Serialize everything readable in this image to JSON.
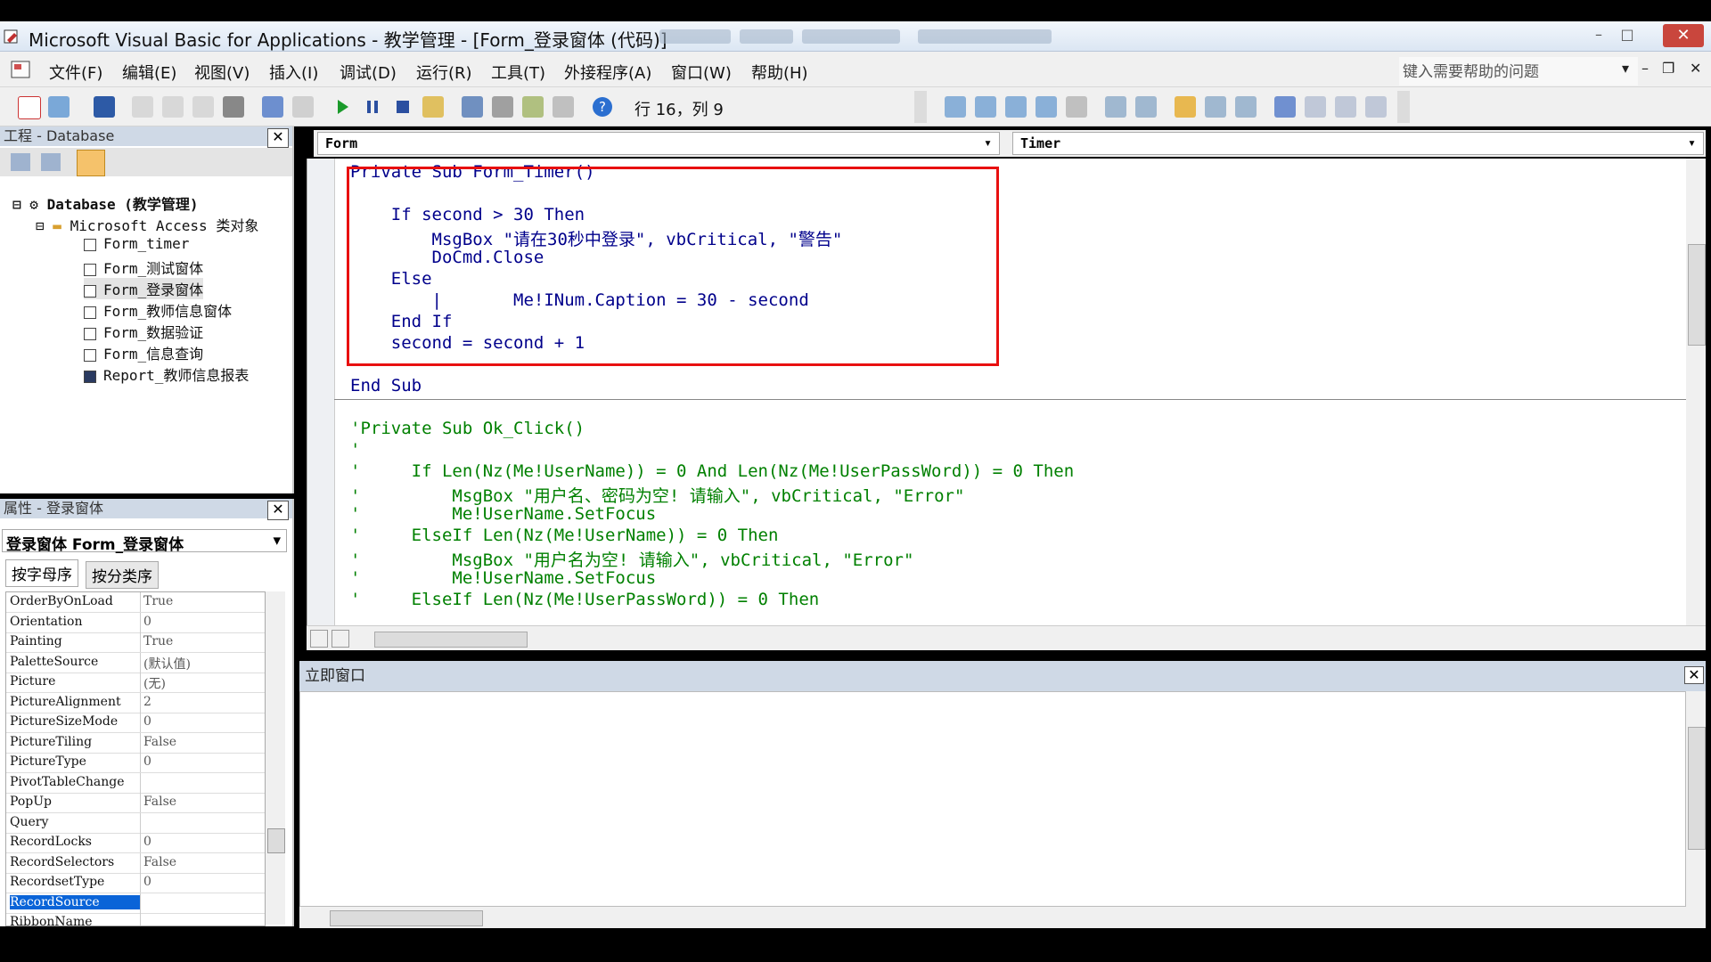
{
  "window": {
    "title": "Microsoft Visual Basic for Applications - 教学管理 - [Form_登录窗体 (代码)]",
    "close_label": "✕"
  },
  "menu": {
    "items": [
      "文件(F)",
      "编辑(E)",
      "视图(V)",
      "插入(I)",
      "调试(D)",
      "运行(R)",
      "工具(T)",
      "外接程序(A)",
      "窗口(W)",
      "帮助(H)"
    ],
    "help_placeholder": "键入需要帮助的问题"
  },
  "toolbar": {
    "position": "行 16，列 9"
  },
  "project_pane": {
    "title": "工程 - Database",
    "root": "Database (教学管理)",
    "folder": "Microsoft Access 类对象",
    "items": [
      "Form_timer",
      "Form_测试窗体",
      "Form_登录窗体",
      "Form_教师信息窗体",
      "Form_数据验证",
      "Form_信息查询",
      "Report_教师信息报表"
    ]
  },
  "properties_pane": {
    "title": "属性 - 登录窗体",
    "object_select": "登录窗体 Form_登录窗体",
    "tabs": [
      "按字母序",
      "按分类序"
    ],
    "rows": [
      {
        "name": "OrderByOnLoad",
        "value": "True"
      },
      {
        "name": "Orientation",
        "value": "0"
      },
      {
        "name": "Painting",
        "value": "True"
      },
      {
        "name": "PaletteSource",
        "value": "(默认值)"
      },
      {
        "name": "Picture",
        "value": "(无)"
      },
      {
        "name": "PictureAlignment",
        "value": "2"
      },
      {
        "name": "PictureSizeMode",
        "value": "0"
      },
      {
        "name": "PictureTiling",
        "value": "False"
      },
      {
        "name": "PictureType",
        "value": "0"
      },
      {
        "name": "PivotTableChange",
        "value": ""
      },
      {
        "name": "PopUp",
        "value": "False"
      },
      {
        "name": "Query",
        "value": ""
      },
      {
        "name": "RecordLocks",
        "value": "0"
      },
      {
        "name": "RecordSelectors",
        "value": "False"
      },
      {
        "name": "RecordsetType",
        "value": "0"
      },
      {
        "name": "RecordSource",
        "value": ""
      },
      {
        "name": "RibbonName",
        "value": ""
      }
    ]
  },
  "code_window": {
    "object_combo": "Form",
    "proc_combo": "Timer",
    "lines": [
      {
        "text": "Private Sub Form_Timer()",
        "kind": "kw"
      },
      {
        "text": "",
        "kind": "kw"
      },
      {
        "text": "    If second > 30 Then",
        "kind": "kw"
      },
      {
        "text": "        MsgBox \"请在30秒中登录\", vbCritical, \"警告\"",
        "kind": "kw"
      },
      {
        "text": "        DoCmd.Close",
        "kind": "kw"
      },
      {
        "text": "    Else",
        "kind": "kw"
      },
      {
        "text": "        |       Me!INum.Caption = 30 - second",
        "kind": "kw"
      },
      {
        "text": "    End If",
        "kind": "kw"
      },
      {
        "text": "    second = second + 1",
        "kind": "kw"
      },
      {
        "text": "",
        "kind": "kw"
      },
      {
        "text": "End Sub",
        "kind": "kw"
      },
      {
        "text": "",
        "kind": "kw"
      },
      {
        "text": "'Private Sub Ok_Click()",
        "kind": "cm"
      },
      {
        "text": "'",
        "kind": "cm"
      },
      {
        "text": "'     If Len(Nz(Me!UserName)) = 0 And Len(Nz(Me!UserPassWord)) = 0 Then",
        "kind": "cm"
      },
      {
        "text": "'         MsgBox \"用户名、密码为空! 请输入\", vbCritical, \"Error\"",
        "kind": "cm"
      },
      {
        "text": "'         Me!UserName.SetFocus",
        "kind": "cm"
      },
      {
        "text": "'     ElseIf Len(Nz(Me!UserName)) = 0 Then",
        "kind": "cm"
      },
      {
        "text": "'         MsgBox \"用户名为空! 请输入\", vbCritical, \"Error\"",
        "kind": "cm"
      },
      {
        "text": "'         Me!UserName.SetFocus",
        "kind": "cm"
      },
      {
        "text": "'     ElseIf Len(Nz(Me!UserPassWord)) = 0 Then",
        "kind": "cm"
      }
    ]
  },
  "immediate": {
    "title": "立即窗口"
  },
  "colors": {
    "keyword": "#00008b",
    "comment": "#008000",
    "highlight_box": "#e81010",
    "selected_row": "#0a64d8"
  }
}
